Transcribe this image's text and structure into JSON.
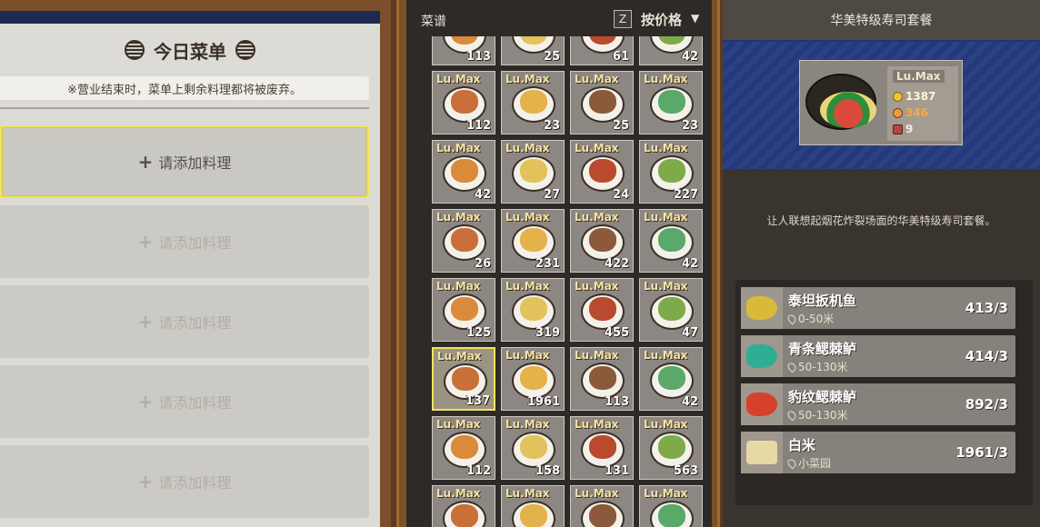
{
  "today_menu": {
    "title": "今日菜单",
    "notice": "※营业结束时，菜单上剩余料理都将被废弃。",
    "slots": [
      {
        "label": "请添加料理",
        "active": true
      },
      {
        "label": "请添加料理",
        "active": false
      },
      {
        "label": "请添加料理",
        "active": false
      },
      {
        "label": "请添加料理",
        "active": false
      },
      {
        "label": "请添加料理",
        "active": false
      }
    ],
    "plus_glyph": "+"
  },
  "recipes": {
    "title": "菜谱",
    "sort_key": "Z",
    "sort_label": "按价格",
    "level_label": "Lu.Max",
    "rows": [
      [
        "113",
        "25",
        "61",
        "42"
      ],
      [
        "112",
        "23",
        "25",
        "23"
      ],
      [
        "42",
        "27",
        "24",
        "227"
      ],
      [
        "26",
        "231",
        "422",
        "42"
      ],
      [
        "125",
        "319",
        "455",
        "47"
      ],
      [
        "137",
        "1961",
        "113",
        "42"
      ],
      [
        "112",
        "158",
        "131",
        "563"
      ],
      [
        "",
        "",
        "",
        ""
      ]
    ],
    "selected": {
      "row": 5,
      "col": 0
    }
  },
  "detail": {
    "title": "华美特级寿司套餐",
    "level": "Lu.Max",
    "price": "1387",
    "customers": "346",
    "eat_count": "9",
    "description": "让人联想起烟花炸裂场面的华美特级寿司套餐。",
    "ingredients": [
      {
        "name": "泰坦扳机鱼",
        "location": "0-50米",
        "qty": "413/3",
        "icon": "fish-icon",
        "color": "#d9b93a"
      },
      {
        "name": "青条鳃棘鲈",
        "location": "50-130米",
        "qty": "414/3",
        "icon": "fish-icon",
        "color": "#2fae93"
      },
      {
        "name": "豹纹鳃棘鲈",
        "location": "50-130米",
        "qty": "892/3",
        "icon": "fish-icon",
        "color": "#d8402e"
      },
      {
        "name": "白米",
        "location": "小菜园",
        "qty": "1961/3",
        "icon": "rice-sack-icon",
        "color": "#e8d8a4"
      }
    ]
  },
  "colors": {
    "highlight": "#f2e45c",
    "banner": "#23397c",
    "wood": "#7d5128"
  }
}
